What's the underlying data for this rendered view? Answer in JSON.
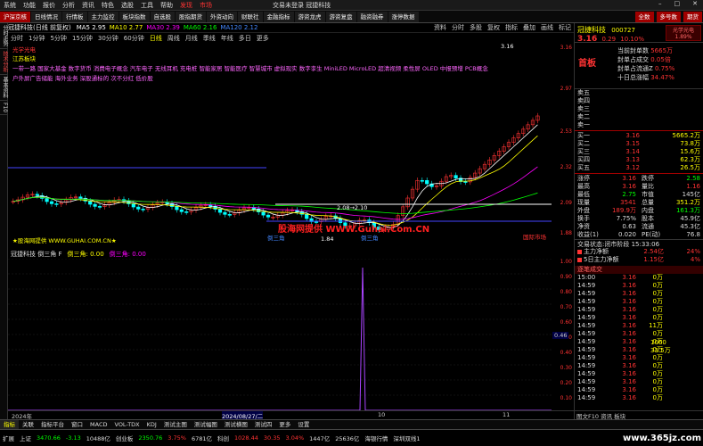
{
  "menubar": {
    "items": [
      "系统",
      "功能",
      "报价",
      "分析",
      "资讯",
      "特色",
      "选股",
      "工具",
      "帮助"
    ],
    "hl": [
      "发现",
      "市场"
    ],
    "title": "交易未登录  冠捷科技"
  },
  "navbar": {
    "tabs": [
      "沪深京核",
      "日线情况",
      "行情板",
      "主力监控",
      "板块指数",
      "自选股",
      "股指期货",
      "外资动向",
      "财联社",
      "金融指标",
      "游资龙虎",
      "游资复盘",
      "融资融券",
      "涨停数据"
    ],
    "right_tabs": [
      "全数",
      "多号数",
      "期货"
    ]
  },
  "sidebar": {
    "items": [
      "分时走势",
      "技术分析",
      "基本资料",
      "F10"
    ]
  },
  "chart_toolbar": {
    "stock": "冠捷科技(日线 前复权)",
    "ma": [
      {
        "label": "MA5",
        "value": "2.95",
        "color": "#ffffff"
      },
      {
        "label": "MA10",
        "value": "2.77",
        "color": "#ffff00"
      },
      {
        "label": "MA30",
        "value": "2.39",
        "color": "#ff00ff"
      },
      {
        "label": "MA60",
        "value": "2.16",
        "color": "#00ff00"
      },
      {
        "label": "MA120",
        "value": "2.12",
        "color": "#4488ff"
      }
    ],
    "right": [
      "资料",
      "分时",
      "多股",
      "复权",
      "指标",
      "叠加",
      "画线",
      "标记"
    ]
  },
  "period_bar": {
    "items": [
      "分时",
      "1分钟",
      "5分钟",
      "15分钟",
      "30分钟",
      "60分钟",
      "日线",
      "周线",
      "月线",
      "季线",
      "年线",
      "多日",
      "更多"
    ],
    "active": "日线"
  },
  "annotations": {
    "line1": "光学光电",
    "line2": "江苏板块",
    "line3": "一带一路 国家大基金 数字货币 消费电子概念 汽车电子 无线耳机 充电桩 智能家居 智能医疗 智慧城市 虚拟现实 数字孪生 MiniLED MicroLED 超清视频 柔性屏 OLED 中报预增 PCB概念",
    "line4": "户外屏广告储能 海外业务 深股通标的 次不分红 低价股",
    "price_high": "3.16",
    "price_low": "1.84",
    "mid_price": "2.08→2.10",
    "left_note": "★股海网提供 WWW.GUHAI.COM.CN★",
    "label_a": "倒三角",
    "label_b": "倒三角",
    "bottom_right": "国际市场"
  },
  "watermark": "股海网提供 WWW.Guhai.Com.CN",
  "main_yaxis": [
    "3.16",
    "2.97",
    "2.53",
    "2.32",
    "2.09",
    "1.88"
  ],
  "sub_title": [
    "冠捷科技 倒三角 F",
    "倒三角: 0.00",
    "倒三角: 0.00"
  ],
  "sub_yaxis": [
    "1.00",
    "0.90",
    "0.80",
    "0.70",
    "0.60",
    "0.50",
    "0.40",
    "0.30",
    "0.20",
    "0.10"
  ],
  "sub_marker": "0.46",
  "dates": [
    "2024年",
    "2024/08/27/二",
    "10",
    "11"
  ],
  "bottom_tabs": [
    "指标",
    "关联",
    "指标平台",
    "窗口",
    "MACD",
    "VOL-TDX",
    "KDJ",
    "测试主图",
    "测试幅图",
    "测试横图",
    "测试四",
    "更多",
    "设置"
  ],
  "bottom_tabs_active": "指标",
  "status": {
    "items": [
      {
        "t": "扩展",
        "c": "#ddd"
      },
      {
        "t": "上证",
        "c": "#ddd"
      },
      {
        "t": "3470.66",
        "c": "#00ff00"
      },
      {
        "t": "-3.13",
        "c": "#00ff00"
      },
      {
        "t": "10488亿",
        "c": "#ddd"
      },
      {
        "t": "创业板",
        "c": "#ddd"
      },
      {
        "t": "2350.76",
        "c": "#00ff00"
      },
      {
        "t": "3.75%",
        "c": "#ff3333"
      },
      {
        "t": "6781亿",
        "c": "#ddd"
      },
      {
        "t": "科创",
        "c": "#ddd"
      },
      {
        "t": "1028.44",
        "c": "#ff3333"
      },
      {
        "t": "30.35",
        "c": "#ff3333"
      },
      {
        "t": "3.04%",
        "c": "#ff3333"
      },
      {
        "t": "1447亿",
        "c": "#ddd"
      },
      {
        "t": "25636亿",
        "c": "#ddd"
      },
      {
        "t": "海银行情",
        "c": "#ddd"
      },
      {
        "t": "深圳双线1",
        "c": "#ddd"
      }
    ]
  },
  "rpanel": {
    "name": "冠捷科技",
    "code": "000727",
    "price": "3.16",
    "change": "0.29",
    "pct": "10.10%",
    "badge1": "光学光电",
    "badge2": "1.89%",
    "promo": "首板",
    "notes": [
      {
        "label": "当前封单数",
        "value": "5665万"
      },
      {
        "label": "封单占成交",
        "value": "0.05倍"
      },
      {
        "label": "封单占流通Z",
        "value": "0.75%"
      },
      {
        "label": "十日总涨幅",
        "value": "34.47%"
      }
    ],
    "asks": [
      {
        "lbl": "卖五",
        "pr": "",
        "vol": ""
      },
      {
        "lbl": "卖四",
        "pr": "",
        "vol": ""
      },
      {
        "lbl": "卖三",
        "pr": "",
        "vol": ""
      },
      {
        "lbl": "卖二",
        "pr": "",
        "vol": ""
      },
      {
        "lbl": "卖一",
        "pr": "",
        "vol": ""
      }
    ],
    "bids": [
      {
        "lbl": "买一",
        "pr": "3.16",
        "vol": "5665.2万"
      },
      {
        "lbl": "买二",
        "pr": "3.15",
        "vol": "73.8万"
      },
      {
        "lbl": "买三",
        "pr": "3.14",
        "vol": "15.6万"
      },
      {
        "lbl": "买四",
        "pr": "3.13",
        "vol": "62.3万"
      },
      {
        "lbl": "买五",
        "pr": "3.12",
        "vol": "26.5万"
      }
    ],
    "stats": [
      {
        "l1": "涨停",
        "v1": "3.16",
        "c1": "#ff3333",
        "l2": "跌停",
        "v2": "2.58",
        "c2": "#00ff00"
      },
      {
        "l1": "最高",
        "v1": "3.16",
        "c1": "#ff3333",
        "l2": "量比",
        "v2": "1.16",
        "c2": "#ff3333"
      },
      {
        "l1": "最低",
        "v1": "2.75",
        "c1": "#00ff00",
        "l2": "市值",
        "v2": "145亿",
        "c2": "#ddd"
      },
      {
        "l1": "现量",
        "v1": "3541",
        "c1": "#ff3333",
        "l2": "总量",
        "v2": "351.2万",
        "c2": "#ffff00"
      },
      {
        "l1": "外盘",
        "v1": "189.9万",
        "c1": "#ff3333",
        "l2": "内盘",
        "v2": "161.3万",
        "c2": "#00ff00"
      },
      {
        "l1": "换手",
        "v1": "7.75%",
        "c1": "#ddd",
        "l2": "股本",
        "v2": "45.9亿",
        "c2": "#ddd"
      },
      {
        "l1": "净资",
        "v1": "0.63",
        "c1": "#ddd",
        "l2": "流通",
        "v2": "45.3亿",
        "c2": "#ddd"
      },
      {
        "l1": "收益(1)",
        "v1": "0.020",
        "c1": "#ddd",
        "l2": "PE(动)",
        "v2": "76.8",
        "c2": "#ddd"
      }
    ],
    "trade_status": "交易状态:闭市阶段 15:33:06",
    "flows": [
      {
        "l": "主力净额",
        "v": "2.54亿",
        "p": "24%",
        "c": "#ff3333"
      },
      {
        "l": "5日主力净额",
        "v": "1.15亿",
        "p": "4%",
        "c": "#ff3333"
      }
    ],
    "ticks_head": "逐笔成交",
    "ticks": [
      {
        "t": "15:00",
        "p": "3.16",
        "v": "0万"
      },
      {
        "t": "14:59",
        "p": "3.16",
        "v": "0万"
      },
      {
        "t": "14:59",
        "p": "3.16",
        "v": "0万"
      },
      {
        "t": "14:59",
        "p": "3.16",
        "v": "0万"
      },
      {
        "t": "14:59",
        "p": "3.16",
        "v": "0万"
      },
      {
        "t": "14:59",
        "p": "3.16",
        "v": "0万"
      },
      {
        "t": "14:59",
        "p": "3.16",
        "v": "11万"
      },
      {
        "t": "14:59",
        "p": "3.16",
        "v": "0万"
      },
      {
        "t": "14:59",
        "p": "3.16",
        "v": "0万"
      },
      {
        "t": "14:59",
        "p": "3.16",
        "v": "0万"
      },
      {
        "t": "14:59",
        "p": "3.16",
        "v": "0万"
      },
      {
        "t": "14:59",
        "p": "3.16",
        "v": "0万"
      },
      {
        "t": "14:59",
        "p": "3.16",
        "v": "0万"
      },
      {
        "t": "14:59",
        "p": "3.16",
        "v": "0万"
      },
      {
        "t": "14:59",
        "p": "3.16",
        "v": "0万"
      },
      {
        "t": "14:59",
        "p": "3.16",
        "v": "0万"
      }
    ],
    "big_vol": "1060",
    "big_vol2": "33.5万",
    "foot": "图文F10 资讯 板块"
  },
  "bottom_watermark": "www.365jz.com"
}
